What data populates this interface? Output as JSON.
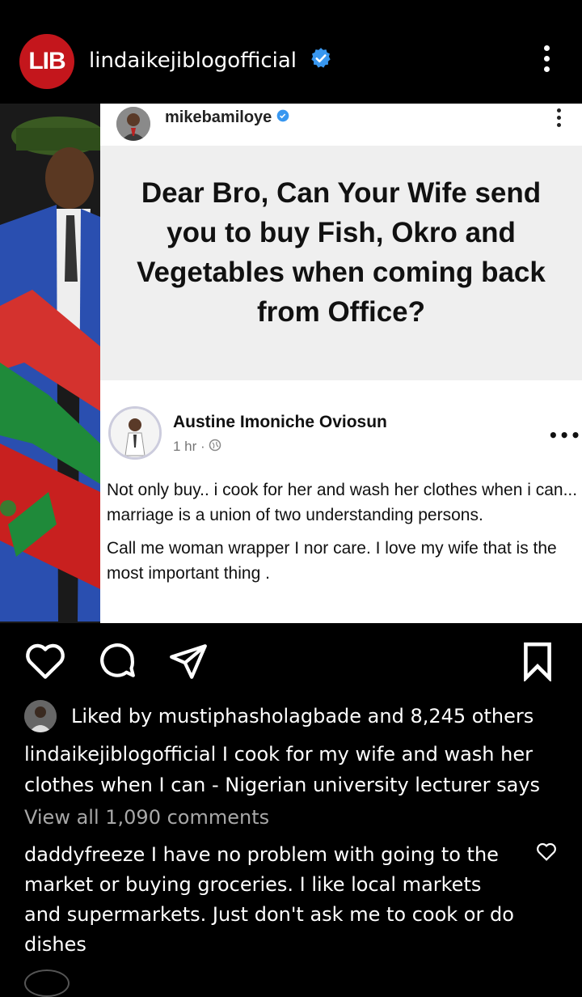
{
  "header": {
    "avatar_text": "LIB",
    "username": "lindaikejiblogofficial",
    "brand_color": "#c4161c",
    "verified_color": "#3897f0"
  },
  "post_image": {
    "tweet": {
      "username": "mikebamiloye",
      "headline": "Dear Bro, Can Your Wife send you to buy Fish, Okro and Vegetables when coming back from Office?"
    },
    "fb_post": {
      "author": "Austine Imoniche Oviosun",
      "time": "1 hr · ",
      "more": "•••",
      "paragraph_1": "Not only buy.. i cook for her and wash her clothes when i can... marriage is a union of two understanding persons.",
      "paragraph_2": "Call me woman wrapper I nor care. I love my wife that is the most important thing ."
    }
  },
  "actions": {
    "like_icon": "heart-outline-icon",
    "comment_icon": "comment-bubble-icon",
    "share_icon": "paper-plane-icon",
    "save_icon": "bookmark-icon"
  },
  "likes": {
    "text": "Liked by mustiphasholagbade and 8,245 others"
  },
  "caption": {
    "username": "lindaikejiblogofficial",
    "text": " I cook for my wife and wash her clothes when I can - Nigerian university lecturer says"
  },
  "comments": {
    "view_all": "View all 1,090 comments",
    "first": {
      "username": "daddyfreeze",
      "text": " I have no problem with going to the market or buying groceries. I like local markets and supermarkets. Just don't ask me to cook or do dishes"
    }
  }
}
